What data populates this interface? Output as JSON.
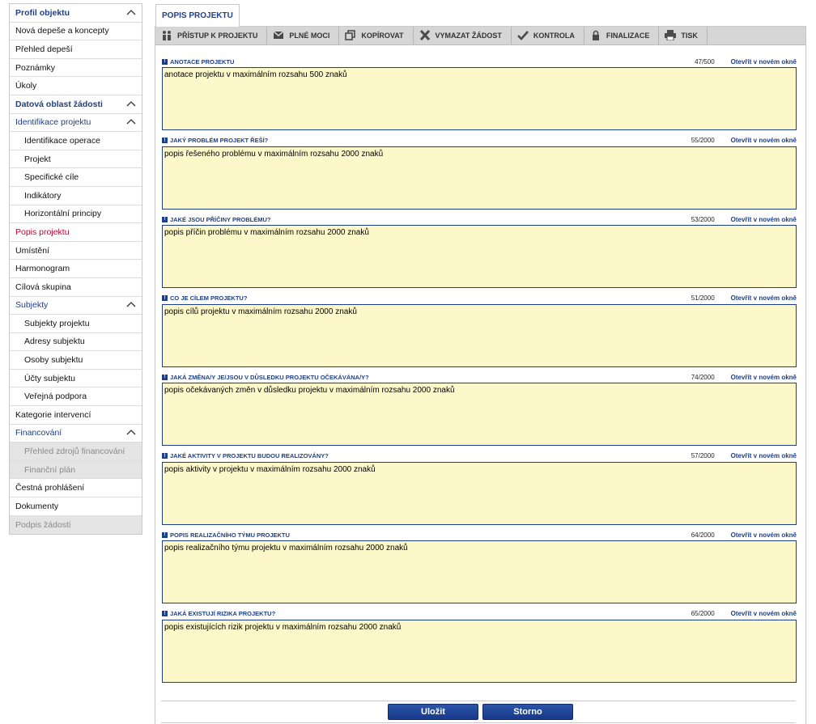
{
  "sidebar": {
    "items": [
      {
        "label": "Profil objektu",
        "kind": "section",
        "collapsible": true
      },
      {
        "label": "Nová depeše a koncepty",
        "kind": "item"
      },
      {
        "label": "Přehled depeší",
        "kind": "item"
      },
      {
        "label": "Poznámky",
        "kind": "item"
      },
      {
        "label": "Úkoly",
        "kind": "item"
      },
      {
        "label": "Datová oblast žádosti",
        "kind": "section",
        "collapsible": true
      },
      {
        "label": "Identifikace projektu",
        "kind": "group",
        "collapsible": true
      },
      {
        "label": "Identifikace operace",
        "kind": "sub"
      },
      {
        "label": "Projekt",
        "kind": "sub"
      },
      {
        "label": "Specifické cíle",
        "kind": "sub"
      },
      {
        "label": "Indikátory",
        "kind": "sub"
      },
      {
        "label": "Horizontální principy",
        "kind": "sub"
      },
      {
        "label": "Popis projektu",
        "kind": "active"
      },
      {
        "label": "Umístění",
        "kind": "item"
      },
      {
        "label": "Harmonogram",
        "kind": "item"
      },
      {
        "label": "Cílová skupina",
        "kind": "item"
      },
      {
        "label": "Subjekty",
        "kind": "group",
        "collapsible": true
      },
      {
        "label": "Subjekty projektu",
        "kind": "sub"
      },
      {
        "label": "Adresy subjektu",
        "kind": "sub"
      },
      {
        "label": "Osoby subjektu",
        "kind": "sub"
      },
      {
        "label": "Účty subjektu",
        "kind": "sub"
      },
      {
        "label": "Veřejná podpora",
        "kind": "sub"
      },
      {
        "label": "Kategorie intervencí",
        "kind": "item"
      },
      {
        "label": "Financování",
        "kind": "group",
        "collapsible": true
      },
      {
        "label": "Přehled zdrojů financování",
        "kind": "sub-disabled"
      },
      {
        "label": "Finanční plán",
        "kind": "sub-disabled"
      },
      {
        "label": "Čestná prohlášení",
        "kind": "item"
      },
      {
        "label": "Dokumenty",
        "kind": "item"
      },
      {
        "label": "Podpis žádosti",
        "kind": "disabled"
      }
    ]
  },
  "main": {
    "tab_label": "POPIS PROJEKTU",
    "toolbar": [
      {
        "label": "PŘÍSTUP K PROJEKTU",
        "icon": "people-icon"
      },
      {
        "label": "PLNÉ MOCI",
        "icon": "envelope-icon"
      },
      {
        "label": "KOPÍROVAT",
        "icon": "copy-icon"
      },
      {
        "label": "VYMAZAT ŽÁDOST",
        "icon": "delete-icon"
      },
      {
        "label": "KONTROLA",
        "icon": "check-icon"
      },
      {
        "label": "FINALIZACE",
        "icon": "lock-icon"
      },
      {
        "label": "TISK",
        "icon": "print-icon"
      }
    ],
    "open_link_label": "Otevřít v novém okně",
    "fields": [
      {
        "label": "ANOTACE PROJEKTU",
        "count": "47/500",
        "value": "anotace projektu v maximálním rozsahu 500 znaků"
      },
      {
        "label": "JAKÝ PROBLÉM PROJEKT ŘEŠÍ?",
        "count": "55/2000",
        "value": "popis řešeného problému v maximálním rozsahu 2000 znaků"
      },
      {
        "label": "JAKÉ JSOU PŘÍČINY PROBLÉMU?",
        "count": "53/2000",
        "value": "popis příčin problému v maximálním rozsahu 2000 znaků"
      },
      {
        "label": "CO JE CÍLEM PROJEKTU?",
        "count": "51/2000",
        "value": "popis cílů projektu v maximálním rozsahu 2000 znaků"
      },
      {
        "label": "JAKÁ ZMĚNA/Y JE/JSOU V DŮSLEDKU PROJEKTU OČEKÁVÁNA/Y?",
        "count": "74/2000",
        "value": "popis očekávaných změn v důsledku projektu v maximálním rozsahu 2000 znaků"
      },
      {
        "label": "JAKÉ AKTIVITY V PROJEKTU BUDOU REALIZOVÁNY?",
        "count": "57/2000",
        "value": "popis aktivity v projektu v maximálním rozsahu 2000 znaků"
      },
      {
        "label": "POPIS REALIZAČNÍHO TÝMU PROJEKTU",
        "count": "64/2000",
        "value": "popis realizačního týmu projektu v maximálním rozsahu 2000 znaků"
      },
      {
        "label": "JAKÁ EXISTUJÍ RIZIKA PROJEKTU?",
        "count": "65/2000",
        "value": "popis existujících rizik projektu v maximálním rozsahu 2000 znaků"
      }
    ],
    "save_label": "Uložit",
    "cancel_label": "Storno"
  },
  "colors": {
    "accent": "#1d3f87",
    "active": "#c3002f",
    "field_bg": "#fdf8c9"
  }
}
